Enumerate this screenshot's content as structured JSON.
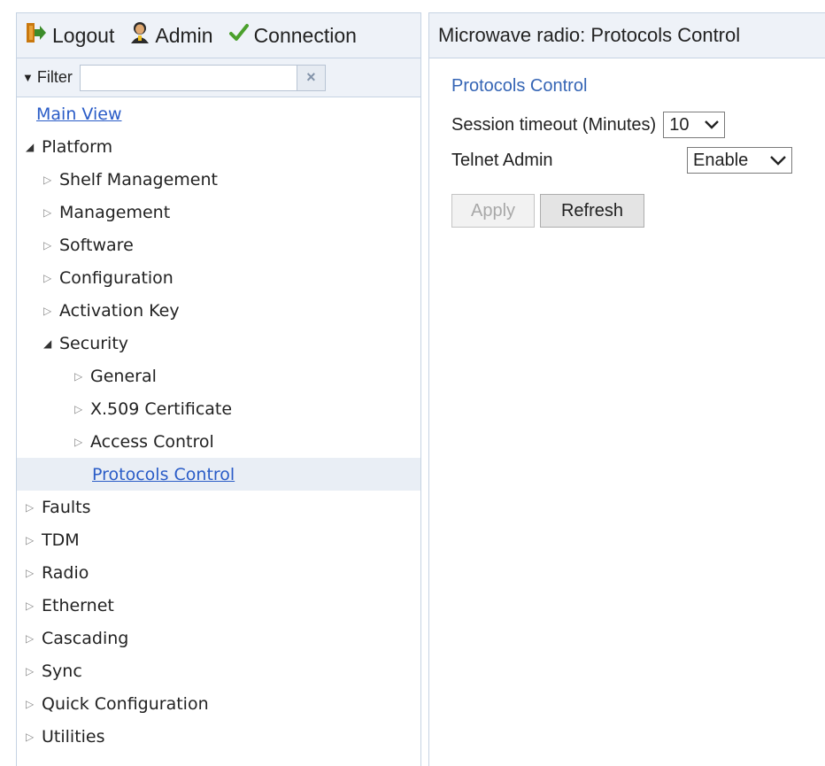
{
  "topbar": {
    "logout_label": "Logout",
    "admin_label": "Admin",
    "connection_label": "Connection"
  },
  "filter": {
    "label": "Filter",
    "value": "",
    "clear_label": "×"
  },
  "tree": [
    {
      "label": "Main View",
      "level": 1,
      "expander": "",
      "link": true,
      "selected": false
    },
    {
      "label": "Platform",
      "level": 0,
      "expander": "open",
      "link": false,
      "selected": false
    },
    {
      "label": "Shelf Management",
      "level": 1,
      "expander": "closed",
      "link": false,
      "selected": false
    },
    {
      "label": "Management",
      "level": 1,
      "expander": "closed",
      "link": false,
      "selected": false
    },
    {
      "label": "Software",
      "level": 1,
      "expander": "closed",
      "link": false,
      "selected": false
    },
    {
      "label": "Configuration",
      "level": 1,
      "expander": "closed",
      "link": false,
      "selected": false
    },
    {
      "label": "Activation Key",
      "level": 1,
      "expander": "closed",
      "link": false,
      "selected": false
    },
    {
      "label": "Security",
      "level": 1,
      "expander": "open",
      "link": false,
      "selected": false
    },
    {
      "label": "General",
      "level": 2,
      "expander": "closed",
      "link": false,
      "selected": false
    },
    {
      "label": "X.509 Certificate",
      "level": 2,
      "expander": "closed",
      "link": false,
      "selected": false
    },
    {
      "label": "Access Control",
      "level": 2,
      "expander": "closed",
      "link": false,
      "selected": false
    },
    {
      "label": "Protocols Control",
      "level": 3,
      "expander": "",
      "link": true,
      "selected": true
    },
    {
      "label": "Faults",
      "level": 0,
      "expander": "closed",
      "link": false,
      "selected": false
    },
    {
      "label": "TDM",
      "level": 0,
      "expander": "closed",
      "link": false,
      "selected": false
    },
    {
      "label": "Radio",
      "level": 0,
      "expander": "closed",
      "link": false,
      "selected": false
    },
    {
      "label": "Ethernet",
      "level": 0,
      "expander": "closed",
      "link": false,
      "selected": false
    },
    {
      "label": "Cascading",
      "level": 0,
      "expander": "closed",
      "link": false,
      "selected": false
    },
    {
      "label": "Sync",
      "level": 0,
      "expander": "closed",
      "link": false,
      "selected": false
    },
    {
      "label": "Quick Configuration",
      "level": 0,
      "expander": "closed",
      "link": false,
      "selected": false
    },
    {
      "label": "Utilities",
      "level": 0,
      "expander": "closed",
      "link": false,
      "selected": false
    }
  ],
  "main": {
    "header": "Microwave radio: Protocols Control",
    "section_title": "Protocols Control",
    "session_timeout_label": "Session timeout (Minutes)",
    "session_timeout_value": "10",
    "telnet_label": "Telnet Admin",
    "telnet_value": "Enable",
    "apply_label": "Apply",
    "refresh_label": "Refresh"
  },
  "colors": {
    "panel_header_bg": "#eef2f8",
    "border": "#c6d3e3",
    "link": "#2a5cc7",
    "selected_row_bg": "#e9eef5",
    "section_title": "#3565b5"
  }
}
